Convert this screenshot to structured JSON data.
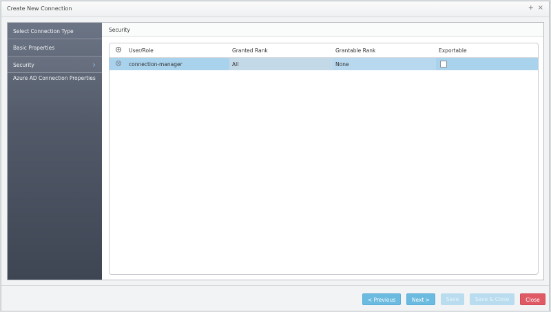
{
  "window": {
    "title": "Create New Connection",
    "maximize_glyph": "+",
    "close_glyph": "×"
  },
  "sidebar": {
    "items": [
      {
        "label": "Select Connection Type"
      },
      {
        "label": "Basic Properties"
      },
      {
        "label": "Security",
        "active": true,
        "chevron": "›"
      },
      {
        "label": "Azure AD Connection Properties"
      }
    ]
  },
  "section": {
    "title": "Security"
  },
  "grid": {
    "add_icon_glyph": "+",
    "remove_icon_glyph": "×",
    "columns": [
      "User/Role",
      "Granted Rank",
      "Grantable Rank",
      "Exportable"
    ],
    "rows": [
      {
        "user_role": "connection-manager",
        "granted_rank": "All",
        "grantable_rank": "None",
        "exportable": false,
        "selected": true
      }
    ]
  },
  "footer": {
    "previous_label": "< Previous",
    "next_label": "Next >",
    "save_label": "Save",
    "save_close_label": "Save & Close",
    "close_label": "Close"
  },
  "colors": {
    "primary_button": "#6bbbe0",
    "disabled_button": "#b9dcef",
    "danger_button": "#e05a66",
    "selected_row": "#a9d2ec",
    "sidebar_top": "#6c7585",
    "sidebar_bottom": "#3e4553"
  }
}
